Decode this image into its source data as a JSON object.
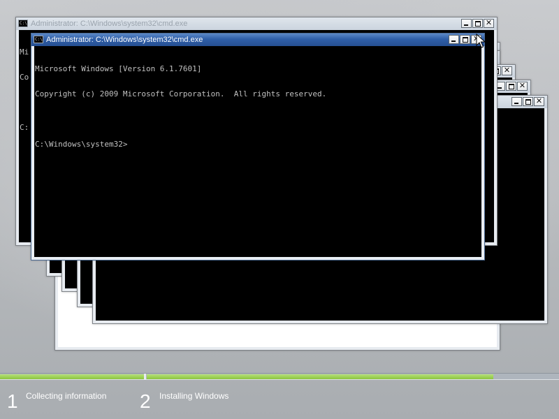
{
  "windows": {
    "back": {
      "title": "Administrator: C:\\Windows\\system32\\cmd.exe",
      "console_lines": [
        "Mi",
        "Co",
        "",
        "C:"
      ]
    },
    "front": {
      "title": "Administrator: C:\\Windows\\system32\\cmd.exe",
      "console_lines": [
        "Microsoft Windows [Version 6.1.7601]",
        "Copyright (c) 2009 Microsoft Corporation.  All rights reserved.",
        "",
        "C:\\Windows\\system32>"
      ]
    },
    "icon_text": "C:\\",
    "close_glyph": "✕"
  },
  "setup": {
    "progress": {
      "step1_fraction": 1.0,
      "step2_fraction": 0.84
    },
    "steps": [
      {
        "number": "1",
        "label": "Collecting information"
      },
      {
        "number": "2",
        "label": "Installing Windows"
      }
    ]
  },
  "icons": {
    "window_icon": "cmd-icon",
    "pointer": "mouse-pointer-icon"
  },
  "colors": {
    "progress_green": "#8ac43e",
    "title_active": "#2f5fa8",
    "console_bg": "#000000",
    "console_text": "#c0c0c0"
  }
}
